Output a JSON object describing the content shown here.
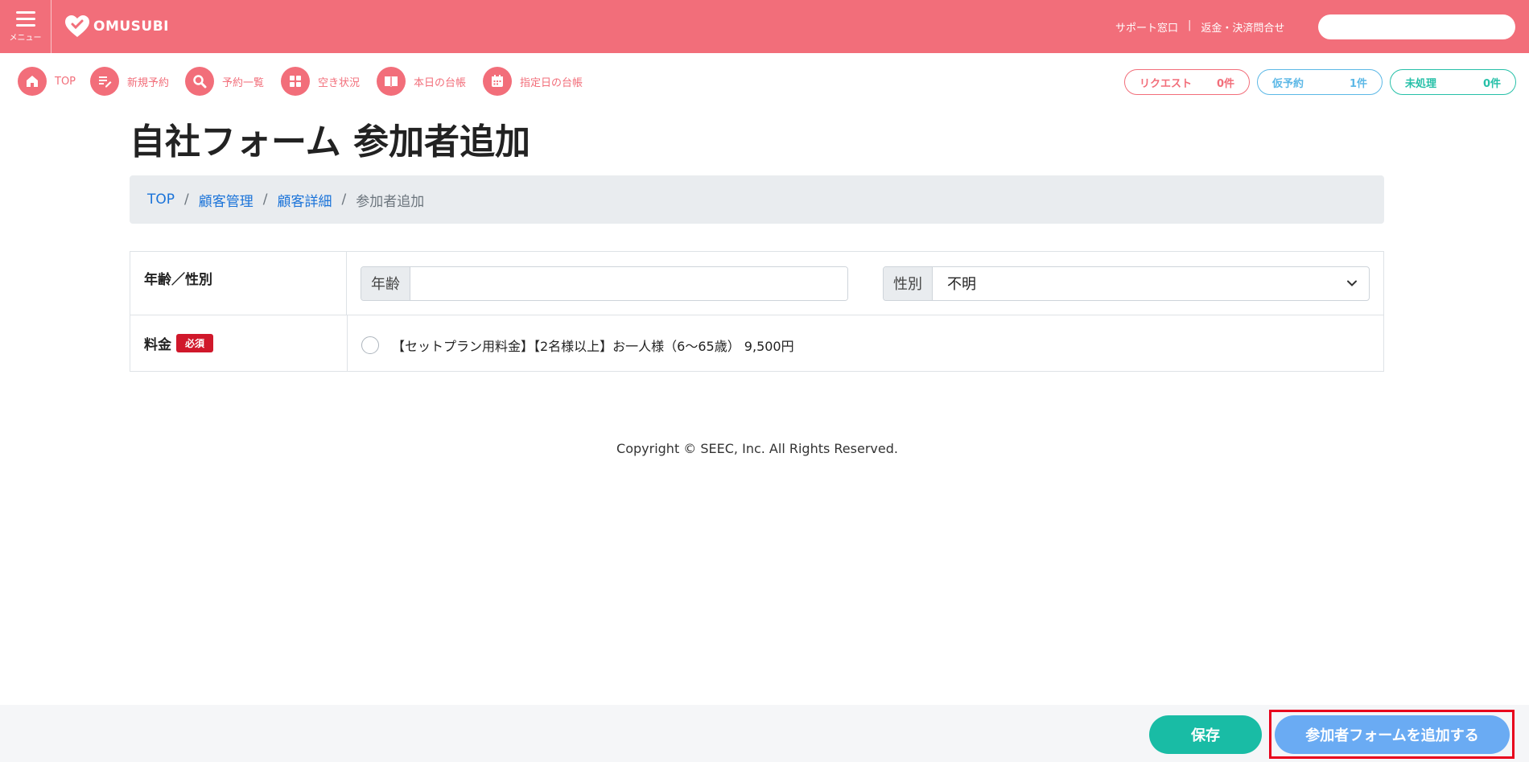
{
  "header": {
    "menu_label": "メニュー",
    "logo_text": "OMUSUBI",
    "support_link": "サポート窓口",
    "separator": "|",
    "refund_link": "返金・決済問合せ",
    "search_value": ""
  },
  "nav": {
    "items": [
      {
        "label": "TOP",
        "icon": "home-icon"
      },
      {
        "label": "新規予約",
        "icon": "edit-icon"
      },
      {
        "label": "予約一覧",
        "icon": "search-icon"
      },
      {
        "label": "空き状況",
        "icon": "grid-icon"
      },
      {
        "label": "本日の台帳",
        "icon": "book-icon"
      },
      {
        "label": "指定日の台帳",
        "icon": "calendar-icon"
      }
    ],
    "badges": [
      {
        "label": "リクエスト",
        "count": "0件",
        "color": "#f26e7a"
      },
      {
        "label": "仮予約",
        "count": "1件",
        "color": "#5cb8e6"
      },
      {
        "label": "未処理",
        "count": "0件",
        "color": "#26c0a8"
      }
    ]
  },
  "main": {
    "title": "自社フォーム 参加者追加",
    "breadcrumb": {
      "items": [
        "TOP",
        "顧客管理",
        "顧客詳細"
      ],
      "separator": "/",
      "current": "参加者追加"
    },
    "form": {
      "age_gender_label": "年齢／性別",
      "age_addon": "年齢",
      "age_value": "",
      "gender_addon": "性別",
      "gender_selected": "不明",
      "fee_label": "料金",
      "required_badge": "必須",
      "fee_option": "【セットプラン用料金】【2名様以上】お一人様（6〜65歳） 9,500円"
    },
    "copyright": "Copyright © SEEC, Inc. All Rights Reserved."
  },
  "footer": {
    "save_label": "保存",
    "add_form_label": "参加者フォームを追加する"
  },
  "colors": {
    "brand": "#f26e7a",
    "save": "#19bca5",
    "add": "#6aabf3",
    "highlight": "#e8001c",
    "required": "#d0182b"
  }
}
